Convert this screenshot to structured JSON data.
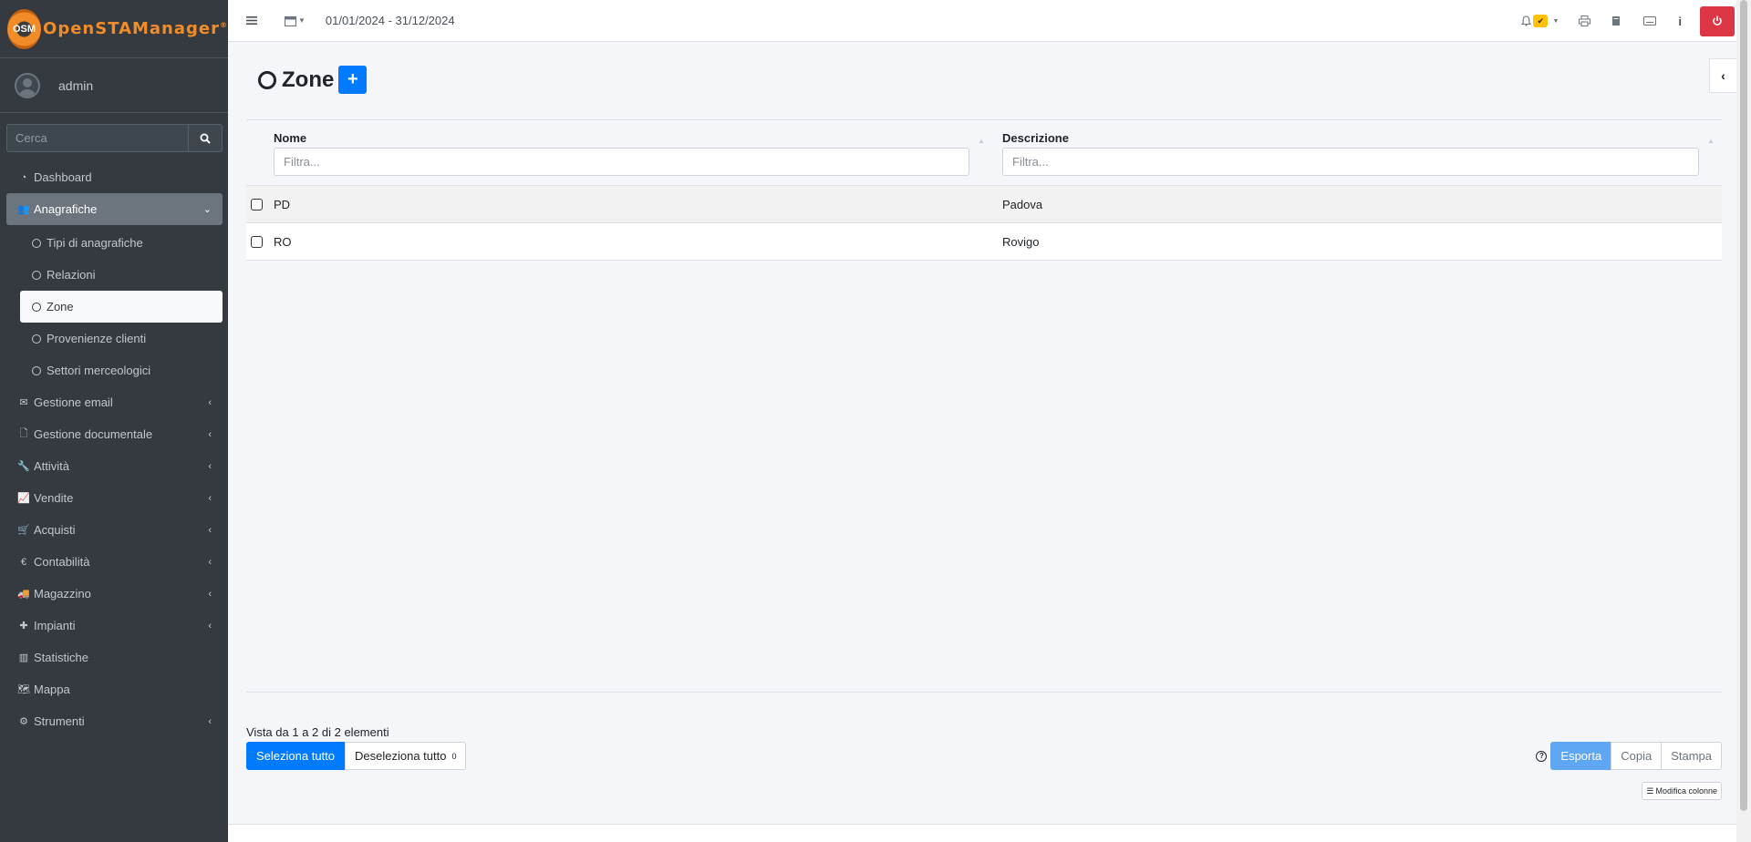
{
  "brand": {
    "logo_text": "OSM",
    "name": "OpenSTAManager"
  },
  "user": {
    "name": "admin"
  },
  "search": {
    "placeholder": "Cerca"
  },
  "sidebar": {
    "items": [
      {
        "label": "Dashboard",
        "icon": "dashboard-icon"
      },
      {
        "label": "Anagrafiche",
        "icon": "users-icon",
        "open": true
      },
      {
        "label": "Gestione email",
        "icon": "envelope-icon"
      },
      {
        "label": "Gestione documentale",
        "icon": "file-icon"
      },
      {
        "label": "Attività",
        "icon": "wrench-icon"
      },
      {
        "label": "Vendite",
        "icon": "chart-line-icon"
      },
      {
        "label": "Acquisti",
        "icon": "cart-icon"
      },
      {
        "label": "Contabilità",
        "icon": "euro-icon"
      },
      {
        "label": "Magazzino",
        "icon": "truck-icon"
      },
      {
        "label": "Impianti",
        "icon": "puzzle-icon"
      },
      {
        "label": "Statistiche",
        "icon": "bar-chart-icon"
      },
      {
        "label": "Mappa",
        "icon": "map-icon"
      },
      {
        "label": "Strumenti",
        "icon": "gear-icon"
      }
    ],
    "subitems": [
      {
        "label": "Tipi di anagrafiche"
      },
      {
        "label": "Relazioni"
      },
      {
        "label": "Zone",
        "active": true
      },
      {
        "label": "Provenienze clienti"
      },
      {
        "label": "Settori merceologici"
      }
    ]
  },
  "topbar": {
    "date_range": "01/01/2024 - 31/12/2024"
  },
  "page": {
    "title": "Zone"
  },
  "table": {
    "columns": [
      {
        "label": "Nome",
        "placeholder": "Filtra..."
      },
      {
        "label": "Descrizione",
        "placeholder": "Filtra..."
      }
    ],
    "rows": [
      {
        "nome": "PD",
        "descrizione": "Padova"
      },
      {
        "nome": "RO",
        "descrizione": "Rovigo"
      }
    ]
  },
  "footer": {
    "info": "Vista da 1 a 2 di 2 elementi",
    "select_all": "Seleziona tutto",
    "deselect_all": "Deseleziona tutto",
    "selected_count": "0",
    "export": "Esporta",
    "copy": "Copia",
    "print": "Stampa",
    "modify_columns": "Modifica colonne"
  },
  "colors": {
    "sidebar_bg": "#343a40",
    "accent": "#007bff",
    "logout": "#dc3545",
    "brand": "#f28c28"
  }
}
